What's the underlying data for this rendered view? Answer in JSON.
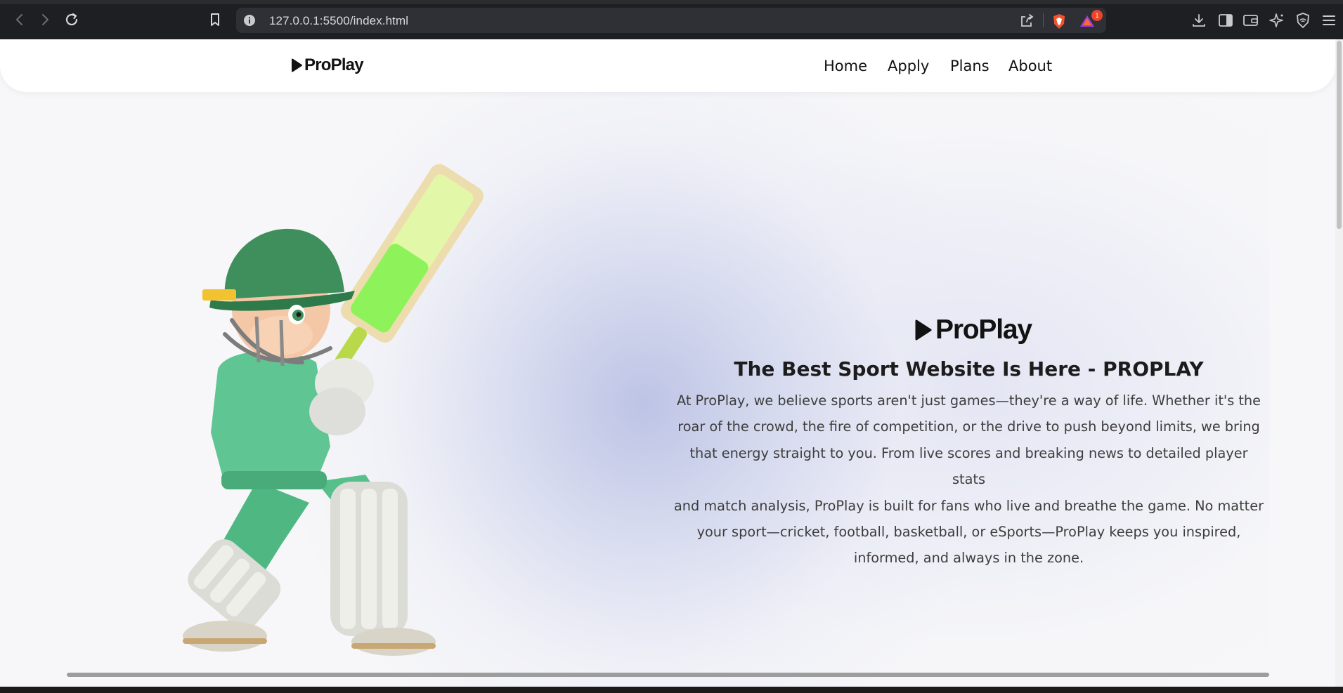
{
  "browser": {
    "url": "127.0.0.1:5500/index.html",
    "notification_count": "1",
    "icons": [
      "back-icon",
      "forward-icon",
      "reload-icon",
      "bookmark-icon",
      "site-info-icon",
      "share-icon",
      "brave-shields-icon",
      "brave-rewards-icon",
      "download-icon",
      "sidebar-icon",
      "wallet-icon",
      "leo-ai-icon",
      "vpn-icon",
      "menu-icon"
    ]
  },
  "header": {
    "logo_text": "ProPlay",
    "nav": [
      {
        "label": "Home"
      },
      {
        "label": "Apply"
      },
      {
        "label": "Plans"
      },
      {
        "label": "About"
      }
    ]
  },
  "hero": {
    "image": "cricket-batsman-illustration",
    "logo_text": "ProPlay",
    "title": "The Best Sport Website Is Here - PROPLAY",
    "lines": [
      "At ProPlay, we believe sports aren't just games—they're a way of life. Whether it's the",
      "roar of the crowd, the fire of competition, or the drive to push beyond limits, we bring",
      "that energy straight to you. From live scores and breaking news to detailed player stats",
      "and match analysis, ProPlay is built for fans who live and breathe the game. No matter",
      "your sport—cricket, football, basketball, or eSports—ProPlay keeps you inspired,",
      "informed, and always in the zone."
    ]
  },
  "colors": {
    "accent_logo": "#121212",
    "hero_gradient": "#c3c8e6",
    "player_green": "#4fb882",
    "bat_green": "#8ef25a"
  }
}
